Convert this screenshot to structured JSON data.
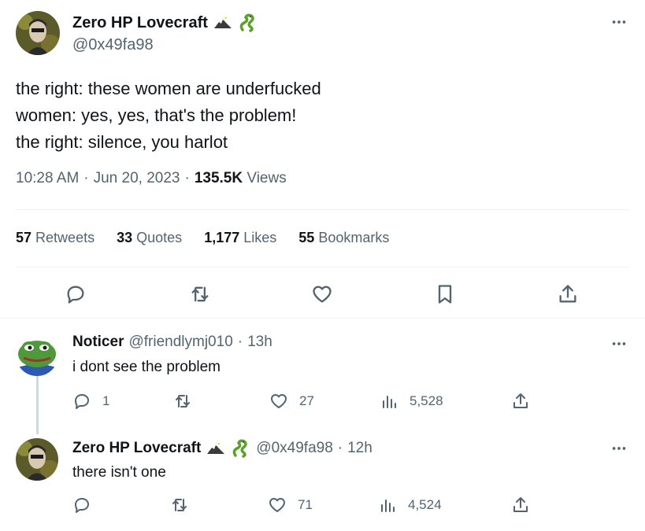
{
  "main_tweet": {
    "author_name": "Zero HP Lovecraft",
    "author_handle": "@0x49fa98",
    "text_lines": [
      "the right: these women are underfucked",
      "women: yes, yes, that's the problem!",
      "the right: silence, you harlot"
    ],
    "time": "10:28 AM",
    "date": "Jun 20, 2023",
    "views_count": "135.5K",
    "views_label": "Views",
    "stats": [
      {
        "num": "57",
        "label": "Retweets"
      },
      {
        "num": "33",
        "label": "Quotes"
      },
      {
        "num": "1,177",
        "label": "Likes"
      },
      {
        "num": "55",
        "label": "Bookmarks"
      }
    ]
  },
  "replies": [
    {
      "author_name": "Noticer",
      "author_handle": "@friendlymj010",
      "time": "13h",
      "text": "i dont see the problem",
      "reply_count": "1",
      "retweet_count": "",
      "like_count": "27",
      "view_count": "5,528"
    },
    {
      "author_name": "Zero HP Lovecraft",
      "author_handle": "@0x49fa98",
      "time": "12h",
      "text": "there isn't one",
      "reply_count": "",
      "retweet_count": "",
      "like_count": "71",
      "view_count": "4,524"
    }
  ],
  "separator": "·",
  "icons": {
    "more": "more-icon",
    "reply": "reply-icon",
    "retweet": "retweet-icon",
    "like": "heart-icon",
    "bookmark": "bookmark-icon",
    "share": "share-icon",
    "views": "views-icon",
    "eagle": "eagle-emoji",
    "snake": "snake-emoji"
  },
  "colors": {
    "text": "#0f1419",
    "muted": "#536471",
    "divider": "#eff3f4",
    "thread_line": "#cfd9de",
    "snake_green": "#5aa02c"
  }
}
